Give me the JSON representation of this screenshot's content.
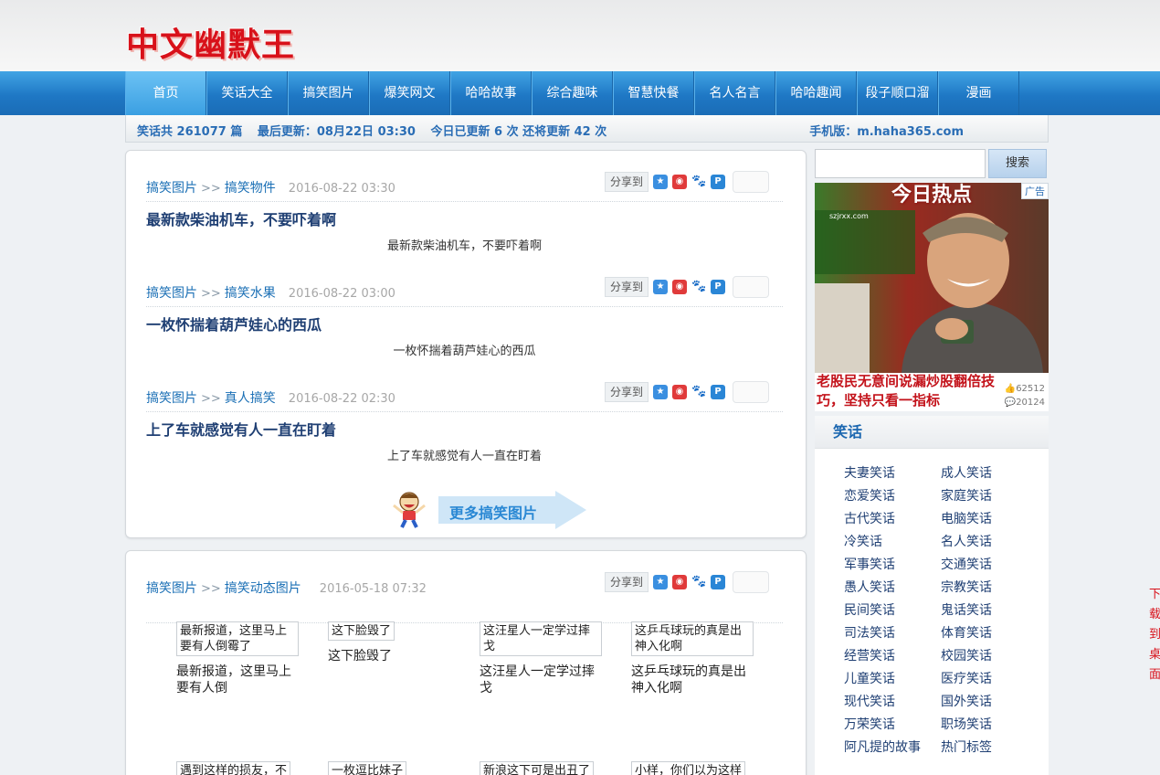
{
  "logo_text": "中文幽默王",
  "nav": {
    "items": [
      "首页",
      "笑话大全",
      "搞笑图片",
      "爆笑网文",
      "哈哈故事",
      "综合趣味",
      "智慧快餐",
      "名人名言",
      "哈哈趣闻",
      "段子顺口溜",
      "漫画"
    ]
  },
  "infobar": {
    "total": "笑话共 261077 篇",
    "last_update": "最后更新：08月22日 03:30",
    "today": "今日已更新 6 次 还将更新 42 次",
    "mobile": "手机版：m.haha365.com"
  },
  "share_label": "分享到",
  "entries": [
    {
      "category": "搞笑图片",
      "sub": "搞笑物件",
      "date": "2016-08-22 03:30",
      "title": "最新款柴油机车，不要吓着啊",
      "desc": "最新款柴油机车，不要吓着啊"
    },
    {
      "category": "搞笑图片",
      "sub": "搞笑水果",
      "date": "2016-08-22 03:00",
      "title": "一枚怀揣着葫芦娃心的西瓜",
      "desc": "一枚怀揣着葫芦娃心的西瓜"
    },
    {
      "category": "搞笑图片",
      "sub": "真人搞笑",
      "date": "2016-08-22 02:30",
      "title": "上了车就感觉有人一直在盯着",
      "desc": "上了车就感觉有人一直在盯着"
    }
  ],
  "sep": ">>",
  "more_label": "更多搞笑图片",
  "box2": {
    "category": "搞笑图片",
    "sub": "搞笑动态图片",
    "date": "2016-05-18 07:32",
    "thumbs": [
      {
        "img": "最新报道，这里马上要有人倒霉了",
        "cap": "最新报道，这里马上要有人倒"
      },
      {
        "img": "这下脸毁了",
        "cap": "这下脸毁了"
      },
      {
        "img": "这汪星人一定学过摔戈",
        "cap": "这汪星人一定学过摔戈"
      },
      {
        "img": "这乒乓球玩的真是出神入化啊",
        "cap": "这乒乓球玩的真是出神入化啊"
      },
      {
        "img": "遇到这样的损友，不",
        "cap": ""
      },
      {
        "img": "一枚逗比妹子",
        "cap": ""
      },
      {
        "img": "新浪这下可是出丑了",
        "cap": ""
      },
      {
        "img": "小样，你们以为这样",
        "cap": ""
      }
    ]
  },
  "search": {
    "button": "搜索",
    "placeholder": ""
  },
  "ad": {
    "hot": "今日热点",
    "tag": "广告",
    "site": "szjrxx.com",
    "headline": "老股民无意间说漏炒股翻倍技巧，坚持只看一指标",
    "likes": "62512",
    "comments": "20124"
  },
  "sidebar": {
    "title": "笑话",
    "categories": [
      "夫妻笑话",
      "成人笑话",
      "恋爱笑话",
      "家庭笑话",
      "古代笑话",
      "电脑笑话",
      "冷笑话",
      "名人笑话",
      "军事笑话",
      "交通笑话",
      "愚人笑话",
      "宗教笑话",
      "民间笑话",
      "鬼话笑话",
      "司法笑话",
      "体育笑话",
      "经营笑话",
      "校园笑话",
      "儿童笑话",
      "医疗笑话",
      "现代笑话",
      "国外笑话",
      "万荣笑话",
      "职场笑话",
      "阿凡提的故事",
      "热门标签"
    ]
  },
  "edge_text": "下载到桌面"
}
